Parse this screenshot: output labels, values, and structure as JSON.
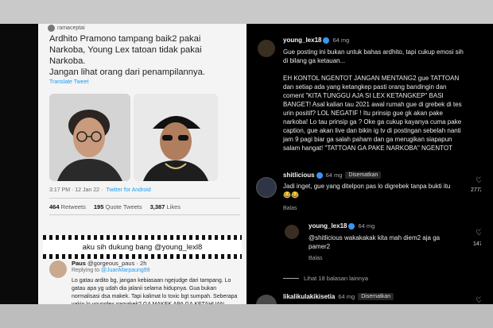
{
  "tweet": {
    "username": "ramaceptai",
    "lines": [
      "Ardhito Pramono tampang baik2 pakai",
      "Narkoba, Young Lex tatoan tidak pakai",
      "Narkoba.",
      "Jangan lihat orang dari penampilannya."
    ],
    "translate": "Translate Tweet",
    "time": "3:17 PM · 12 Jan 22 ·",
    "source": "Twitter for Android",
    "retweets": "464",
    "retweets_label": "Retweets",
    "quotes": "195",
    "quotes_label": "Quote Tweets",
    "likes": "3,387",
    "likes_label": "Likes",
    "slogan": "aku sih dukung bang @young_lexl8",
    "reply": {
      "name": "Paus",
      "handle": "@gorgeous_paus · 2h",
      "replying_to_label": "Replying to",
      "replying_to": "@JuanMarpaung99",
      "body": "Lo gatau ardito bg, jangan kebiasaan ngejudge dari tampang. Lo gatau apa yg udah dia jalanii selama hidupnya. Gua bukan normalisasi dsa makek. Tapi kalimat lo toxic bgt sumpah. Seberapa yakin lo younglex gamakek? GA MAKEK APA GA KETAHUAN"
    }
  },
  "instagram": {
    "post": {
      "username": "young_lex18",
      "time": "64 mg",
      "paragraphs": [
        "Gue posting ini bukan untuk bahas ardhito, tapi cukup emosi sih di bilang ga ketauan...",
        "EH KONTOL NGENTOT JANGAN MENTANG2 gue TATTOAN dan setiap ada yang ketangkep pasti orang bandingin dan coment \"KITA TUNGGU AJA SI LEX KETANGKEP\" BASI BANGET! Asal kalian tau 2021 awal rumah gue di grebek di tes urin positif? LOL NEGATIF ! Itu prinsip gue gk akan pake narkoba! Lo tau prinsip ga ? Oke ga cukup kayanya cuma pake caption, gue akan live dan bikin ig tv di postingan sebelah nanti jam 9 pagi biar ga salah paham dan ga merugikan siapapun salam hangat! \"TATTOAN GA PAKE NARKOBA\" NGENTOT"
      ]
    },
    "comment1": {
      "username": "shitlicious",
      "time": "64 mg",
      "pinned": "Disematkan",
      "text": "Jadi inget, gue yang ditelpon pas lo digrebek tanpa bukti itu 😂😂",
      "reply_label": "Balas",
      "likes": "2772"
    },
    "comment2": {
      "username": "young_lex18",
      "time": "64 mg",
      "text": "@shitlicious wakakakak kita mah diem2 aja ga pamer2",
      "reply_label": "Balas",
      "likes": "1474"
    },
    "more_replies": "Lihat 18 balasan lainnya",
    "comment3": {
      "username": "likalikulakikisetia",
      "time": "64 mg",
      "pinned": "Disematkan"
    }
  }
}
